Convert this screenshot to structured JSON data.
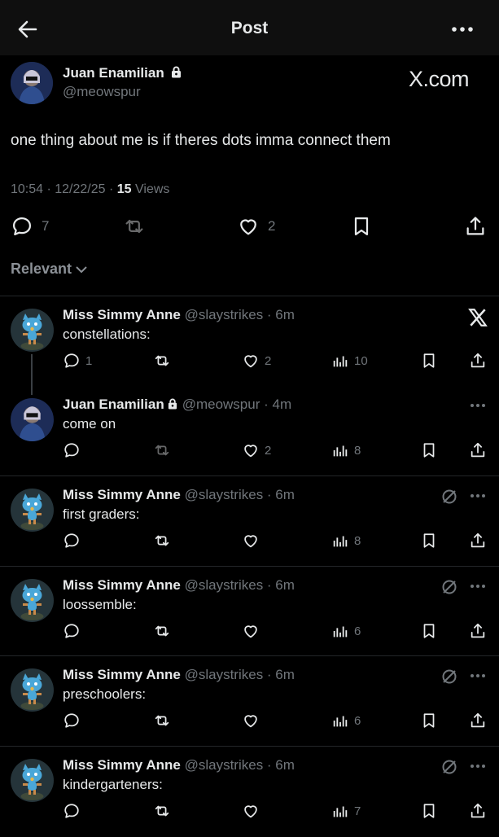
{
  "header": {
    "title": "Post",
    "back_icon": "back-arrow-icon",
    "more_icon": "more-icon"
  },
  "main_post": {
    "name": "Juan Enamilian",
    "handle": "@meowspur",
    "watermark": "X.com",
    "text": "one thing about me is if theres dots imma connect them",
    "time": "10:54 · 12/22/25 · ",
    "views_count": "15",
    "views_label": " Views",
    "replies": "7",
    "reposts": "",
    "likes": "2"
  },
  "sort": {
    "label": "Relevant"
  },
  "replies": [
    {
      "name": "Miss Simmy Anne",
      "handle": "@slaystrikes · 6m",
      "text": "constellations:",
      "comments": "1",
      "reposts": "",
      "likes": "2",
      "views": "10",
      "top_icon": "x-logo-icon"
    },
    {
      "name": "Juan Enamilian",
      "handle": "@meowspur · 4m",
      "text": "come on",
      "comments": "",
      "reposts": "",
      "likes": "2",
      "views": "8",
      "top_icon": "more-icon"
    },
    {
      "name": "Miss Simmy Anne",
      "handle": "@slaystrikes · 6m",
      "text": "first graders:",
      "comments": "",
      "reposts": "",
      "likes": "",
      "views": "8",
      "top_icon": "hidden-icon"
    },
    {
      "name": "Miss Simmy Anne",
      "handle": "@slaystrikes · 6m",
      "text": "loossemble:",
      "comments": "",
      "reposts": "",
      "likes": "",
      "views": "6",
      "top_icon": "hidden-icon"
    },
    {
      "name": "Miss Simmy Anne",
      "handle": "@slaystrikes · 6m",
      "text": "preschoolers:",
      "comments": "",
      "reposts": "",
      "likes": "",
      "views": "6",
      "top_icon": "hidden-icon"
    },
    {
      "name": "Miss Simmy Anne",
      "handle": "@slaystrikes · 6m",
      "text": "kindergarteners:",
      "comments": "",
      "reposts": "",
      "likes": "",
      "views": "7",
      "top_icon": "hidden-icon"
    }
  ]
}
